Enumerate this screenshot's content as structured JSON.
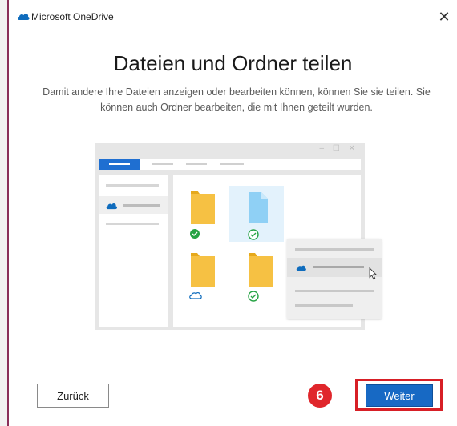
{
  "window": {
    "title": "Microsoft OneDrive",
    "close_symbol": "✕"
  },
  "dialog": {
    "heading": "Dateien und Ordner teilen",
    "subtitle": "Damit andere Ihre Dateien anzeigen oder bearbeiten können, können Sie sie teilen. Sie können auch Ordner bearbeiten, die mit Ihnen geteilt wurden."
  },
  "illustration": {
    "window_controls": "– ☐ ✕",
    "items": [
      {
        "kind": "folder",
        "status": "synced-check"
      },
      {
        "kind": "file",
        "status": "available-check",
        "selected": true
      },
      {
        "kind": "folder",
        "status": "cloud-only"
      },
      {
        "kind": "folder",
        "status": "available-check"
      }
    ]
  },
  "buttons": {
    "back": "Zurück",
    "next": "Weiter"
  },
  "annotation": {
    "step_number": "6",
    "highlight_color": "#d71f26"
  },
  "colors": {
    "accent": "#1769c4",
    "onedrive_blue": "#0f6cbd",
    "check_green": "#27a345",
    "folder_yellow": "#f6c143",
    "file_blue": "#8fd0f5"
  }
}
